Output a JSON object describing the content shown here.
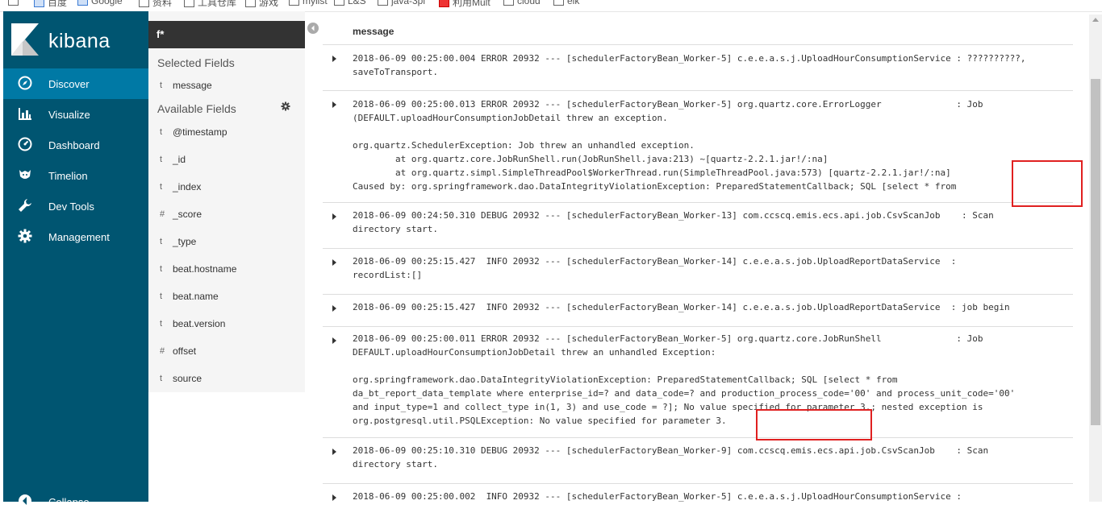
{
  "bookmarks": [
    {
      "label": "百度",
      "icon": "paw-icon"
    },
    {
      "label": "Google",
      "icon": "google-icon"
    },
    {
      "label": "资料",
      "icon": "folder-icon"
    },
    {
      "label": "工具仓库",
      "icon": "folder-icon"
    },
    {
      "label": "游戏",
      "icon": "folder-icon"
    },
    {
      "label": "mylist",
      "icon": "folder-icon"
    },
    {
      "label": "L&S",
      "icon": "folder-icon"
    },
    {
      "label": "java-3pi",
      "icon": "folder-icon"
    },
    {
      "label": "利用Mult",
      "icon": "red-icon"
    },
    {
      "label": "cloud",
      "icon": "folder-icon"
    },
    {
      "label": "elk",
      "icon": "folder-icon"
    }
  ],
  "app": {
    "name": "kibana"
  },
  "nav": {
    "items": [
      {
        "label": "Discover",
        "icon": "compass-icon",
        "active": true
      },
      {
        "label": "Visualize",
        "icon": "bar-chart-icon"
      },
      {
        "label": "Dashboard",
        "icon": "dashboard-icon"
      },
      {
        "label": "Timelion",
        "icon": "timelion-icon"
      },
      {
        "label": "Dev Tools",
        "icon": "wrench-icon"
      },
      {
        "label": "Management",
        "icon": "gear-icon"
      }
    ],
    "collapse_label": "Collapse"
  },
  "sidebar": {
    "index_pattern": "f*",
    "selected_title": "Selected Fields",
    "selected": [
      {
        "type": "t",
        "name": "message"
      }
    ],
    "available_title": "Available Fields",
    "available": [
      {
        "type": "t",
        "name": "@timestamp"
      },
      {
        "type": "t",
        "name": "_id"
      },
      {
        "type": "t",
        "name": "_index"
      },
      {
        "type": "#",
        "name": "_score"
      },
      {
        "type": "t",
        "name": "_type"
      },
      {
        "type": "t",
        "name": "beat.hostname"
      },
      {
        "type": "t",
        "name": "beat.name"
      },
      {
        "type": "t",
        "name": "beat.version"
      },
      {
        "type": "#",
        "name": "offset"
      },
      {
        "type": "t",
        "name": "source"
      }
    ]
  },
  "table": {
    "column": "message",
    "rows": [
      "2018-06-09 00:25:00.004 ERROR 20932 --- [schedulerFactoryBean_Worker-5] c.e.e.a.s.j.UploadHourConsumptionService : ??????????,\nsaveToTransport.",
      "2018-06-09 00:25:00.013 ERROR 20932 --- [schedulerFactoryBean_Worker-5] org.quartz.core.ErrorLogger              : Job\n(DEFAULT.uploadHourConsumptionJobDetail threw an exception.\n\norg.quartz.SchedulerException: Job threw an unhandled exception.\n        at org.quartz.core.JobRunShell.run(JobRunShell.java:213) ~[quartz-2.2.1.jar!/:na]\n        at org.quartz.simpl.SimpleThreadPool$WorkerThread.run(SimpleThreadPool.java:573) [quartz-2.2.1.jar!/:na]\nCaused by: org.springframework.dao.DataIntegrityViolationException: PreparedStatementCallback; SQL [select * from",
      "2018-06-09 00:24:50.310 DEBUG 20932 --- [schedulerFactoryBean_Worker-13] com.ccscq.emis.ecs.api.job.CsvScanJob    : Scan\ndirectory start.",
      "2018-06-09 00:25:15.427  INFO 20932 --- [schedulerFactoryBean_Worker-14] c.e.e.a.s.job.UploadReportDataService  :\nrecordList:[]",
      "2018-06-09 00:25:15.427  INFO 20932 --- [schedulerFactoryBean_Worker-14] c.e.e.a.s.job.UploadReportDataService  : job begin",
      "2018-06-09 00:25:00.011 ERROR 20932 --- [schedulerFactoryBean_Worker-5] org.quartz.core.JobRunShell              : Job\nDEFAULT.uploadHourConsumptionJobDetail threw an unhandled Exception:\n\norg.springframework.dao.DataIntegrityViolationException: PreparedStatementCallback; SQL [select * from\nda_bt_report_data_template where enterprise_id=? and data_code=? and production_process_code='00' and process_unit_code='00'\nand input_type=1 and collect_type in(1, 3) and use_code = ?]; No value specified for parameter 3.; nested exception is\norg.postgresql.util.PSQLException: No value specified for parameter 3.",
      "2018-06-09 00:25:10.310 DEBUG 20932 --- [schedulerFactoryBean_Worker-9] com.ccscq.emis.ecs.api.job.CsvScanJob    : Scan\ndirectory start.",
      "2018-06-09 00:25:00.002  INFO 20932 --- [schedulerFactoryBean_Worker-5] c.e.e.a.s.j.UploadHourConsumptionService :"
    ]
  },
  "colors": {
    "nav_bg": "#005571",
    "nav_active": "#0079a5",
    "annotation": "#e02020"
  }
}
